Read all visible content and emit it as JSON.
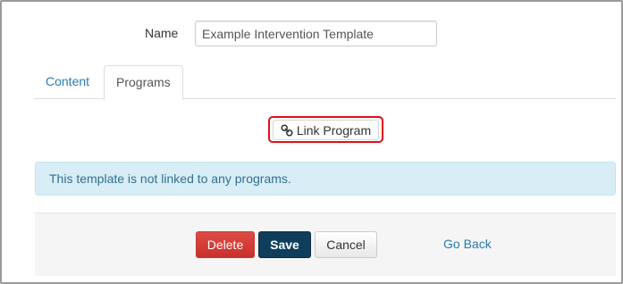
{
  "form": {
    "name_label": "Name",
    "name_value": "Example Intervention Template"
  },
  "tabs": [
    {
      "label": "Content",
      "active": false
    },
    {
      "label": "Programs",
      "active": true
    }
  ],
  "programs": {
    "link_button_label": "Link Program",
    "link_icon": "link-icon",
    "empty_message": "This template is not linked to any programs."
  },
  "actions": {
    "delete_label": "Delete",
    "save_label": "Save",
    "cancel_label": "Cancel",
    "go_back_label": "Go Back"
  },
  "colors": {
    "accent_link": "#2a7ab0",
    "delete": "#d9413d",
    "save": "#0f3e5c",
    "info_bg": "#d9edf7",
    "info_text": "#31708f",
    "highlight": "#e0101a"
  }
}
